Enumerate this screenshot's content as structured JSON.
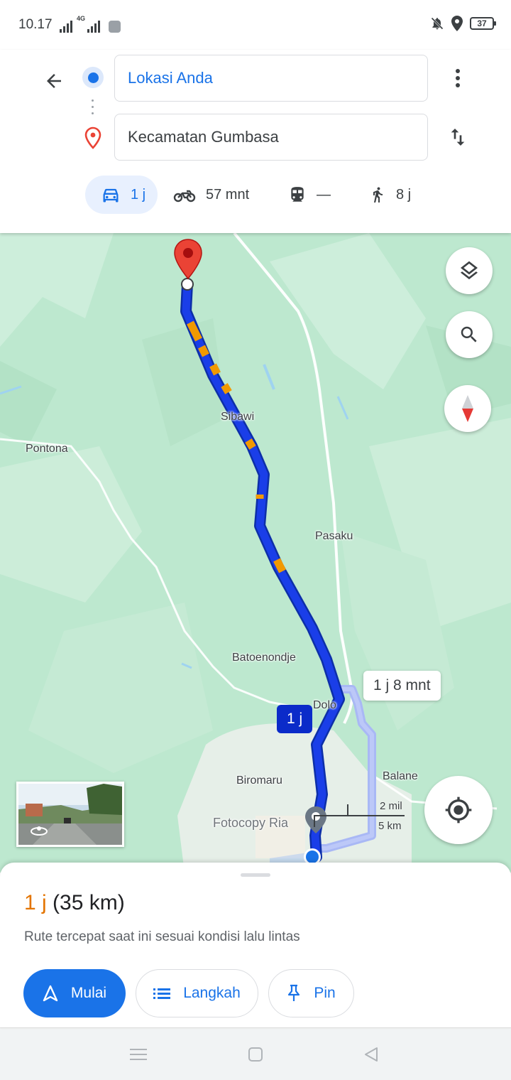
{
  "status_bar": {
    "time": "10.17",
    "network_label": "4G",
    "battery": "37",
    "icons": [
      "signal-icon",
      "signal-4g-icon",
      "app-notification-icon",
      "mute-icon",
      "location-icon",
      "battery-icon"
    ]
  },
  "directions": {
    "origin": "Lokasi Anda",
    "destination": "Kecamatan Gumbasa",
    "modes": [
      {
        "name": "car",
        "label": "1 j",
        "active": true
      },
      {
        "name": "motorcycle",
        "label": "57 mnt"
      },
      {
        "name": "transit",
        "label": "—"
      },
      {
        "name": "walking",
        "label": "8 j"
      }
    ]
  },
  "map": {
    "place_labels": [
      "Sibawi",
      "Pontona",
      "Pasaku",
      "Batoenondje",
      "Dolo",
      "Biromaru",
      "Balane"
    ],
    "poi_label": "Fotocopy Ria",
    "selected_route_label": "1 j",
    "alternate_route_label": "1 j 8 mnt",
    "scale": {
      "top": "2 mil",
      "bottom": "5 km"
    },
    "colors": {
      "route": "#1a3ee8",
      "alt_route": "#a9b8f5",
      "traffic_slow": "#f29900",
      "destination_pin": "#ea4335",
      "land": "#bde8cf"
    }
  },
  "summary": {
    "duration": "1 j",
    "distance": "(35 km)",
    "description": "Rute tercepat saat ini sesuai kondisi lalu lintas"
  },
  "actions": {
    "start": "Mulai",
    "steps": "Langkah",
    "pin": "Pin"
  }
}
